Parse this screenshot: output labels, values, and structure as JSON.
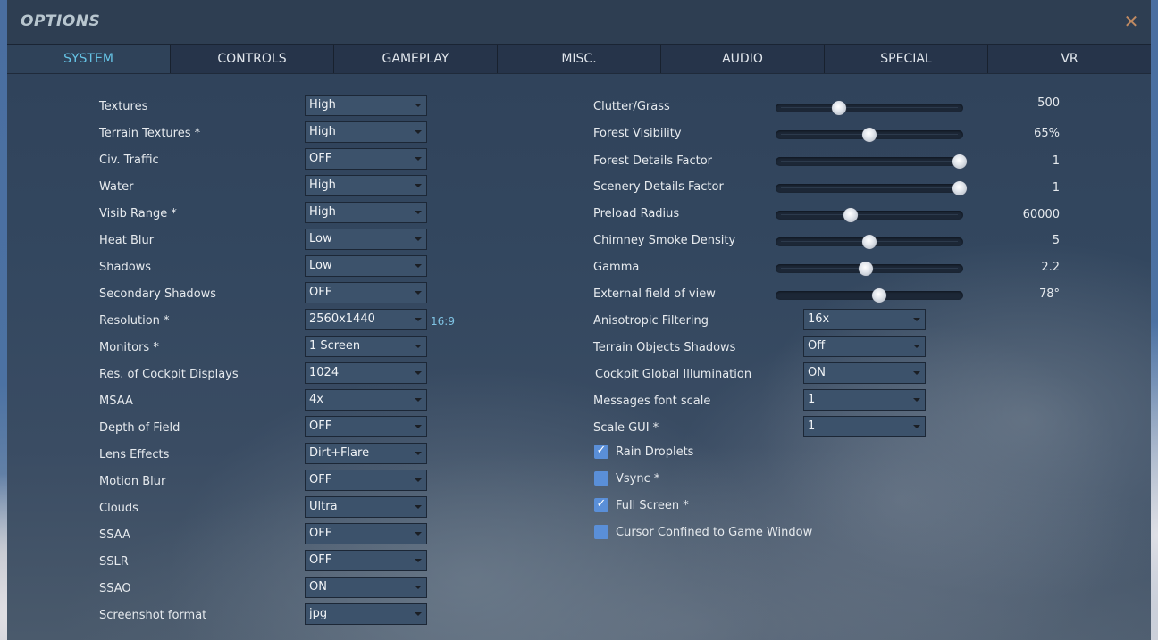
{
  "window": {
    "title": "OPTIONS",
    "close_icon": "close-icon"
  },
  "tabs": [
    {
      "label": "SYSTEM",
      "active": true
    },
    {
      "label": "CONTROLS",
      "active": false
    },
    {
      "label": "GAMEPLAY",
      "active": false
    },
    {
      "label": "MISC.",
      "active": false
    },
    {
      "label": "AUDIO",
      "active": false
    },
    {
      "label": "SPECIAL",
      "active": false
    },
    {
      "label": "VR",
      "active": false
    }
  ],
  "left_settings": [
    {
      "label": "Textures",
      "value": "High"
    },
    {
      "label": "Terrain Textures *",
      "value": "High"
    },
    {
      "label": "Civ. Traffic",
      "value": "OFF"
    },
    {
      "label": "Water",
      "value": "High"
    },
    {
      "label": "Visib Range *",
      "value": "High"
    },
    {
      "label": "Heat Blur",
      "value": "Low"
    },
    {
      "label": "Shadows",
      "value": "Low"
    },
    {
      "label": "Secondary Shadows",
      "value": "OFF"
    },
    {
      "label": "Resolution *",
      "value": "2560x1440",
      "aspect": "16:9"
    },
    {
      "label": "Monitors *",
      "value": "1 Screen"
    },
    {
      "label": "Res. of Cockpit Displays",
      "value": "1024"
    },
    {
      "label": "MSAA",
      "value": "4x"
    },
    {
      "label": "Depth of Field",
      "value": "OFF"
    },
    {
      "label": "Lens Effects",
      "value": "Dirt+Flare"
    },
    {
      "label": "Motion Blur",
      "value": "OFF"
    },
    {
      "label": "Clouds",
      "value": "Ultra"
    },
    {
      "label": "SSAA",
      "value": "OFF"
    },
    {
      "label": "SSLR",
      "value": "OFF"
    },
    {
      "label": "SSAO",
      "value": "ON"
    },
    {
      "label": "Screenshot format",
      "value": "jpg"
    }
  ],
  "sliders": [
    {
      "label": "Clutter/Grass",
      "value": "500",
      "position": 0.34
    },
    {
      "label": "Forest Visibility",
      "value": "65%",
      "position": 0.5
    },
    {
      "label": "Forest Details Factor",
      "value": "1",
      "position": 0.98
    },
    {
      "label": "Scenery Details Factor",
      "value": "1",
      "position": 0.98
    },
    {
      "label": "Preload Radius",
      "value": "60000",
      "position": 0.4
    },
    {
      "label": "Chimney Smoke Density",
      "value": "5",
      "position": 0.5
    },
    {
      "label": "Gamma",
      "value": "2.2",
      "position": 0.48
    },
    {
      "label": "External field of view",
      "value": "78°",
      "position": 0.55
    }
  ],
  "right_dropdowns": [
    {
      "label": "Anisotropic Filtering",
      "value": "16x"
    },
    {
      "label": "Terrain Objects Shadows",
      "value": "Off"
    },
    {
      "label": "Cockpit Global Illumination",
      "value": "ON"
    },
    {
      "label": "Messages font scale",
      "value": "1"
    },
    {
      "label": "Scale GUI *",
      "value": "1"
    }
  ],
  "checkboxes": [
    {
      "label": "Rain Droplets",
      "checked": true
    },
    {
      "label": "Vsync *",
      "checked": false
    },
    {
      "label": "Full Screen *",
      "checked": true
    },
    {
      "label": "Cursor Confined to Game Window",
      "checked": false
    }
  ],
  "glyphs": {
    "close": "✕",
    "check": "✓"
  },
  "colors": {
    "active_tab_text": "#66c4e6",
    "aspect_text": "#7fc3e3",
    "close_icon": "#c08a62",
    "checkbox": "#5a8fd8"
  }
}
